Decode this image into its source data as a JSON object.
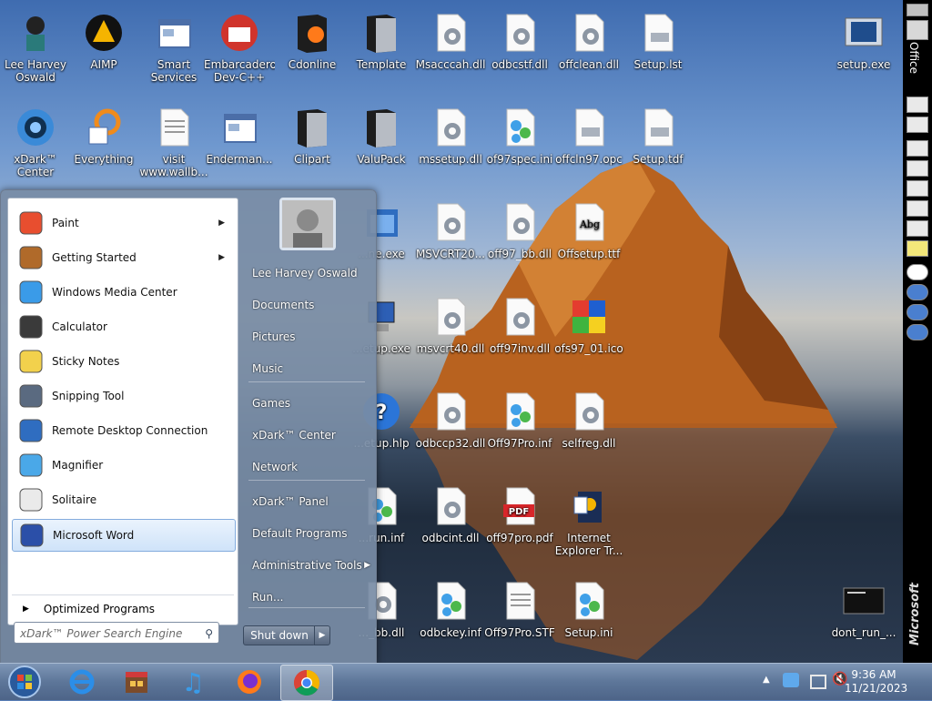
{
  "desktop_icons": [
    {
      "label": "Lee Harvey Oswald",
      "icon": "user-icon"
    },
    {
      "label": "AIMP",
      "icon": "aimp-icon"
    },
    {
      "label": "Smart Services",
      "icon": "window-icon"
    },
    {
      "label": "Embarcadero Dev-C++",
      "icon": "devcpp-icon"
    },
    {
      "label": "Cdonline",
      "icon": "firefox-folder-icon"
    },
    {
      "label": "Template",
      "icon": "folder-icon"
    },
    {
      "label": "Msacccah.dll",
      "icon": "gear-file-icon"
    },
    {
      "label": "odbcstf.dll",
      "icon": "gear-file-icon"
    },
    {
      "label": "offclean.dll",
      "icon": "gear-file-icon"
    },
    {
      "label": "Setup.lst",
      "icon": "settings-file-icon"
    },
    {
      "label": "setup.exe",
      "icon": "setup-exe-icon"
    },
    {
      "label": "xDark™ Center",
      "icon": "xdark-icon"
    },
    {
      "label": "Everything",
      "icon": "search-app-icon"
    },
    {
      "label": "visit www.wallb...",
      "icon": "text-file-icon"
    },
    {
      "label": "Enderman...",
      "icon": "window-icon"
    },
    {
      "label": "Clipart",
      "icon": "folder-icon"
    },
    {
      "label": "ValuPack",
      "icon": "folder-icon"
    },
    {
      "label": "mssetup.dll",
      "icon": "gear-file-icon"
    },
    {
      "label": "of97spec.ini",
      "icon": "ini-file-icon"
    },
    {
      "label": "offcln97.opc",
      "icon": "settings-file-icon"
    },
    {
      "label": "Setup.tdf",
      "icon": "settings-file-icon"
    },
    {
      "label": "...ne.exe",
      "icon": "exe-icon"
    },
    {
      "label": "MSVCRT20...",
      "icon": "gear-file-icon"
    },
    {
      "label": "off97_bb.dll",
      "icon": "gear-file-icon"
    },
    {
      "label": "Offsetup.ttf",
      "icon": "font-file-icon"
    },
    {
      "label": "...etup.exe",
      "icon": "computer-icon"
    },
    {
      "label": "msvcrt40.dll",
      "icon": "gear-file-icon"
    },
    {
      "label": "off97inv.dll",
      "icon": "gear-file-icon"
    },
    {
      "label": "ofs97_01.ico",
      "icon": "puzzle-icon"
    },
    {
      "label": "...etup.hlp",
      "icon": "help-icon"
    },
    {
      "label": "odbccp32.dll",
      "icon": "gear-file-icon"
    },
    {
      "label": "Off97Pro.inf",
      "icon": "ini-file-icon"
    },
    {
      "label": "selfreg.dll",
      "icon": "gear-file-icon"
    },
    {
      "label": "...run.inf",
      "icon": "ini-file-icon"
    },
    {
      "label": "odbcint.dll",
      "icon": "gear-file-icon"
    },
    {
      "label": "off97pro.pdf",
      "icon": "pdf-icon"
    },
    {
      "label": "Internet Explorer Tr...",
      "icon": "ie-tour-icon"
    },
    {
      "label": "..._bb.dll",
      "icon": "gear-file-icon"
    },
    {
      "label": "odbckey.inf",
      "icon": "ini-file-icon"
    },
    {
      "label": "Off97Pro.STF",
      "icon": "text-file-icon"
    },
    {
      "label": "Setup.ini",
      "icon": "ini-file-icon"
    },
    {
      "label": "dont_run_...",
      "icon": "terminal-icon"
    }
  ],
  "start_menu": {
    "programs": [
      {
        "label": "Paint",
        "has_submenu": true
      },
      {
        "label": "Getting Started",
        "has_submenu": true
      },
      {
        "label": "Windows Media Center",
        "has_submenu": false
      },
      {
        "label": "Calculator",
        "has_submenu": false
      },
      {
        "label": "Sticky Notes",
        "has_submenu": false
      },
      {
        "label": "Snipping Tool",
        "has_submenu": false
      },
      {
        "label": "Remote Desktop Connection",
        "has_submenu": false
      },
      {
        "label": "Magnifier",
        "has_submenu": false
      },
      {
        "label": "Solitaire",
        "has_submenu": false
      },
      {
        "label": "Microsoft Word",
        "has_submenu": false,
        "selected": true
      }
    ],
    "optimized_programs": "Optimized Programs",
    "search_placeholder": "xDark™ Power Search Engine",
    "right_links": [
      {
        "label": "Lee Harvey Oswald"
      },
      {
        "label": "Documents"
      },
      {
        "label": "Pictures"
      },
      {
        "label": "Music"
      },
      {
        "label": "Games"
      },
      {
        "label": "xDark™ Center"
      },
      {
        "label": "Network"
      },
      {
        "label": "xDark™ Panel"
      },
      {
        "label": "Default Programs"
      },
      {
        "label": "Administrative Tools",
        "has_submenu": true
      },
      {
        "label": "Run..."
      }
    ],
    "shutdown_label": "Shut down"
  },
  "taskbar": {
    "pinned": [
      "start-orb",
      "internet-explorer",
      "store",
      "music-player",
      "firefox",
      "chrome"
    ],
    "active": "chrome",
    "time": "9:36 AM",
    "date": "11/21/2023"
  },
  "office_bar": {
    "label": "Office",
    "brand": "Microsoft"
  }
}
